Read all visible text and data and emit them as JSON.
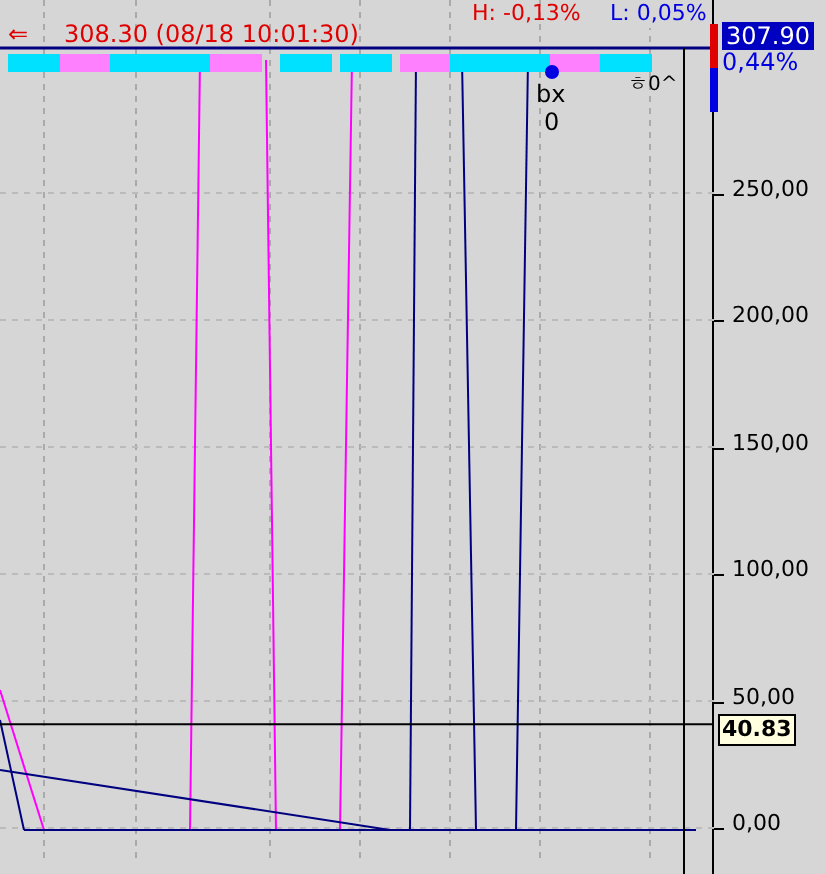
{
  "header": {
    "arrow": "⇐",
    "last_trade": "308.30 (08/18 10:01:30)",
    "high": "H: -0,13%",
    "low": "L: 0,05%",
    "overlay_tail": "ㅎ0^"
  },
  "marker": {
    "label": "bx",
    "value": "0"
  },
  "price_axis": {
    "current_price": "307.90",
    "change": "0,44%",
    "cursor_value": "40.83",
    "ticks": [
      "250,00",
      "200,00",
      "150,00",
      "100,00",
      "50,00",
      "0,00"
    ]
  }
}
